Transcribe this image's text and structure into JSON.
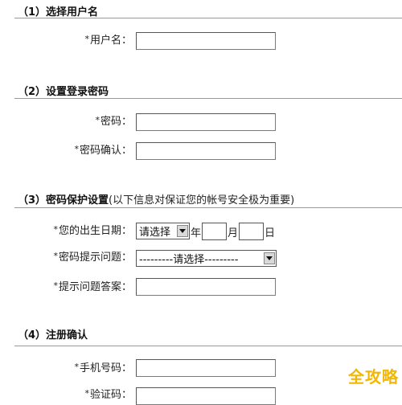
{
  "sections": {
    "username": {
      "title": "（1）选择用户名"
    },
    "password": {
      "title": "（2）设置登录密码"
    },
    "protect": {
      "title": "（3）密码保护设置",
      "note": "(以下信息对保证您的帐号安全极为重要)"
    },
    "confirm": {
      "title": "（4）注册确认"
    }
  },
  "fields": {
    "required_mark": "*",
    "username": {
      "label": "用户名：",
      "value": ""
    },
    "password": {
      "label": "密码：",
      "value": ""
    },
    "password_confirm": {
      "label": "密码确认：",
      "value": ""
    },
    "birthday": {
      "label": "您的出生日期：",
      "year_select": "请选择",
      "year_unit": "年",
      "month_unit": "月",
      "day_unit": "日",
      "month_value": "",
      "day_value": ""
    },
    "question": {
      "label": "密码提示问题：",
      "select": "---------请选择---------"
    },
    "answer": {
      "label": "提示问题答案：",
      "value": ""
    },
    "phone": {
      "label": "手机号码：",
      "value": ""
    },
    "code": {
      "label": "验证码：",
      "value": ""
    }
  },
  "watermark": "全攻略",
  "colors": {
    "watermark": "#f2b705",
    "rule": "#9a9a9a"
  }
}
